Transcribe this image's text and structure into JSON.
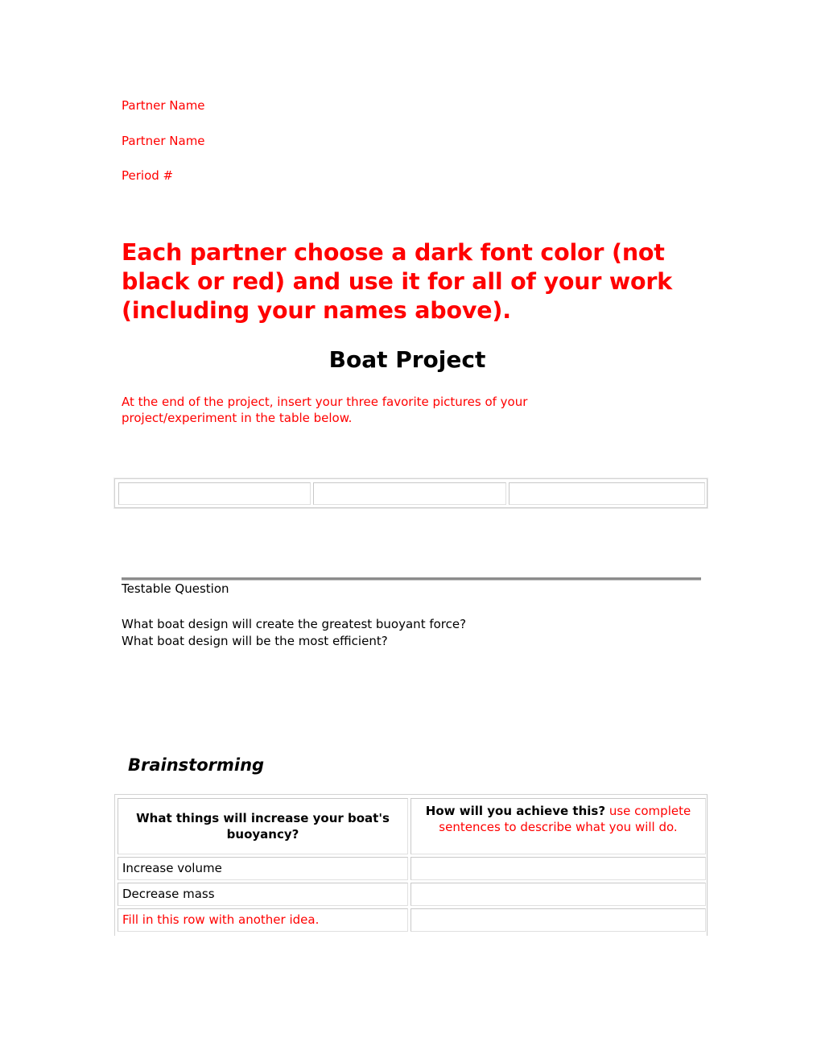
{
  "header": {
    "partner_name_1": "Partner Name",
    "partner_name_2": "Partner Name",
    "period": "Period #"
  },
  "instruction": "Each partner choose a dark font color (not black or red) and use it for all of your work (including your names above).",
  "title": "Boat Project",
  "intro": "At the end of the project, insert your three favorite pictures of your project/experiment in the table below.",
  "pictures_table": {
    "cells": [
      "",
      "",
      ""
    ]
  },
  "testable_question": {
    "label": "Testable Question",
    "questions": [
      "What boat design will create the greatest buoyant force?",
      "What boat design will be the most efficient?"
    ]
  },
  "brainstorming": {
    "heading": "Brainstorming",
    "columns": [
      {
        "label": "What things will increase your boat's buoyancy?"
      },
      {
        "label": "How will you achieve this?",
        "hint": "use complete sentences to describe what you will do."
      }
    ],
    "rows": [
      {
        "idea": "Increase volume",
        "method": "",
        "idea_is_prompt": false
      },
      {
        "idea": "Decrease mass",
        "method": "",
        "idea_is_prompt": false
      },
      {
        "idea": "Fill in this row with another idea.",
        "method": "",
        "idea_is_prompt": true
      }
    ]
  },
  "colors": {
    "instruction_red": "#ff0000",
    "text": "#000000",
    "table_border": "#c8c8c8"
  }
}
